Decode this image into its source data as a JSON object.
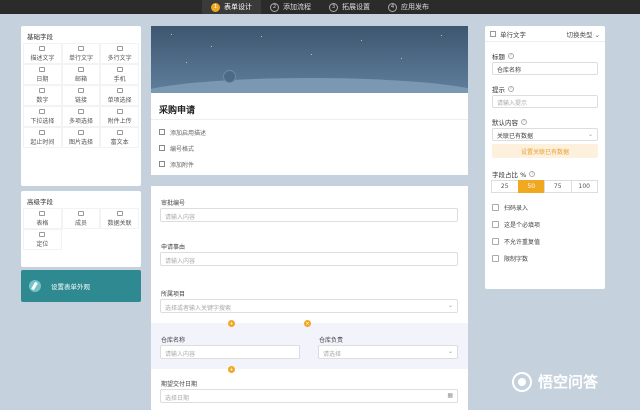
{
  "steps": [
    {
      "num": "1",
      "label": "表单设计"
    },
    {
      "num": "2",
      "label": "添加流程"
    },
    {
      "num": "3",
      "label": "拓展设置"
    },
    {
      "num": "4",
      "label": "应用发布"
    }
  ],
  "basic_fields": {
    "title": "基础字段",
    "items": [
      "描述文字",
      "单行文字",
      "多行文字",
      "日期",
      "邮箱",
      "手机",
      "数字",
      "链接",
      "单项选择",
      "下拉选择",
      "多项选择",
      "附件上传",
      "起止时间",
      "图片选择",
      "富文本"
    ]
  },
  "advanced_fields": {
    "title": "高级字段",
    "items": [
      "表格",
      "成员",
      "数据关联",
      "定位"
    ]
  },
  "banner": {
    "label": "设置表单外观"
  },
  "form": {
    "title": "采购申请",
    "options": [
      "添加启用描述",
      "编号格式",
      "添加附件"
    ],
    "fields": [
      {
        "label": "审批编号",
        "placeholder": "请输入内容"
      },
      {
        "label": "申请事由",
        "placeholder": "请输入内容"
      },
      {
        "label": "所属项目",
        "placeholder": "选择或者输入关键字搜索"
      },
      {
        "label": "仓库名称",
        "placeholder": "请输入内容"
      },
      {
        "label": "仓库负责",
        "placeholder": "请选择"
      },
      {
        "label": "期望交付日期",
        "placeholder": "选择日期"
      }
    ]
  },
  "props": {
    "type_label": "单行文字",
    "switch_label": "切换类型",
    "title_label": "标题",
    "title_value": "仓库名称",
    "hint_label": "提示",
    "hint_placeholder": "请输入提示",
    "default_label": "默认内容",
    "default_value": "关联已有数据",
    "link_button": "设置关联已有数据",
    "width_label": "字段占比 %",
    "widths": [
      "25",
      "50",
      "75",
      "100"
    ],
    "width_selected": "50",
    "checks": [
      "扫码录入",
      "这是个必填项",
      "不允许重复值",
      "限制字数"
    ]
  },
  "watermark": {
    "text": "悟空问答"
  }
}
